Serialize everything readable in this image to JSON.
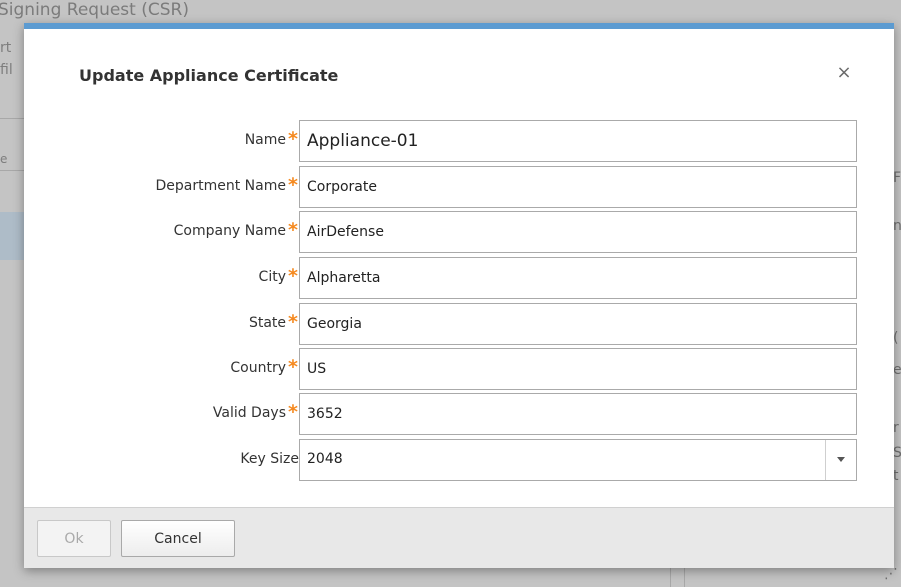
{
  "background": {
    "title_fragment": "Signing Request (CSR)",
    "side_fragments": [
      "rt",
      "fil",
      "e"
    ],
    "right_fragments": [
      "F",
      "n",
      "(",
      "e",
      "r",
      "S",
      "t"
    ]
  },
  "dialog": {
    "title": "Update Appliance Certificate",
    "close_glyph": "×",
    "required_marker": "*",
    "fields": {
      "name": {
        "label": "Name",
        "value": "Appliance-01"
      },
      "department": {
        "label": "Department Name",
        "value": "Corporate"
      },
      "company": {
        "label": "Company Name",
        "value": "AirDefense"
      },
      "city": {
        "label": "City",
        "value": "Alpharetta"
      },
      "state": {
        "label": "State",
        "value": "Georgia"
      },
      "country": {
        "label": "Country",
        "value": "US"
      },
      "valid_days": {
        "label": "Valid Days",
        "value": "3652"
      },
      "key_size": {
        "label": "Key Size",
        "value": "2048"
      }
    },
    "buttons": {
      "ok_label": "Ok",
      "cancel_label": "Cancel"
    }
  },
  "colors": {
    "accent_top_border": "#5c9bd1",
    "required_star": "#f5891f",
    "footer_bg": "#e8e8e8"
  }
}
